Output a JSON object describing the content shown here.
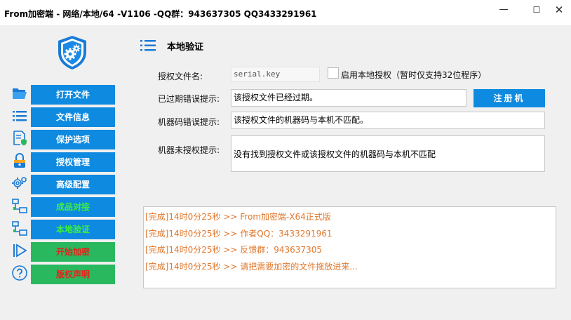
{
  "window": {
    "title": "From加密端 - 网络/本地/64 -V1106     -QQ群：943637305  QQ3433291961",
    "min_symbol": "—",
    "max_symbol": "☐",
    "close_symbol": "✕"
  },
  "logo": {
    "icon": "shield-gears-icon"
  },
  "nav": {
    "items": [
      {
        "label": "打开文件",
        "icon": "open-folder-icon",
        "style": "blue",
        "text_color": "#ffffff"
      },
      {
        "label": "文件信息",
        "icon": "list-icon",
        "style": "blue",
        "text_color": "#ffffff"
      },
      {
        "label": "保护选项",
        "icon": "document-shield-icon",
        "style": "blue",
        "text_color": "#ffffff"
      },
      {
        "label": "授权管理",
        "icon": "lock-icon",
        "style": "blue",
        "text_color": "#ffffff"
      },
      {
        "label": "高级配置",
        "icon": "gear-icon",
        "style": "blue",
        "text_color": "#ffffff"
      },
      {
        "label": "成品对接",
        "icon": "network-icon",
        "style": "blue",
        "text_color": "#3cf03c"
      },
      {
        "label": "本地验证",
        "icon": "network-icon",
        "style": "blue",
        "text_color": "#3cf03c"
      },
      {
        "label": "开始加密",
        "icon": "play-icon",
        "style": "green",
        "text_color": "#e8201a"
      },
      {
        "label": "版权声明",
        "icon": "help-icon",
        "style": "green",
        "text_color": "#e8201a"
      }
    ]
  },
  "section": {
    "title": "本地验证",
    "icon": "list-icon"
  },
  "form": {
    "license_file_label": "授权文件名:",
    "license_file_value": "serial.key",
    "local_license_label": "启用本地授权（暂时仅支持32位程序）",
    "expired_label": "已过期错误提示:",
    "expired_value": "该授权文件已经过期。",
    "register_label": "注册机",
    "mismatch_label": "机器码错误提示:",
    "mismatch_value": "该授权文件的机器码与本机不匹配。",
    "unlicensed_label": "机器未授权提示:",
    "unlicensed_value": "没有找到授权文件或该授权文件的机器码与本机不匹配"
  },
  "log": {
    "lines": [
      "[完成]14时0分25秒 >> From加密端-X64正式版",
      "[完成]14时0分25秒 >> 作者QQ：3433291961",
      "[完成]14时0分25秒 >> 反馈群：943637305",
      "[完成]14时0分25秒 >> 请把需要加密的文件拖放进来..."
    ]
  },
  "colors": {
    "accent_blue": "#0e8ae0",
    "accent_green": "#2ab85f",
    "log_text": "#e0782d"
  }
}
